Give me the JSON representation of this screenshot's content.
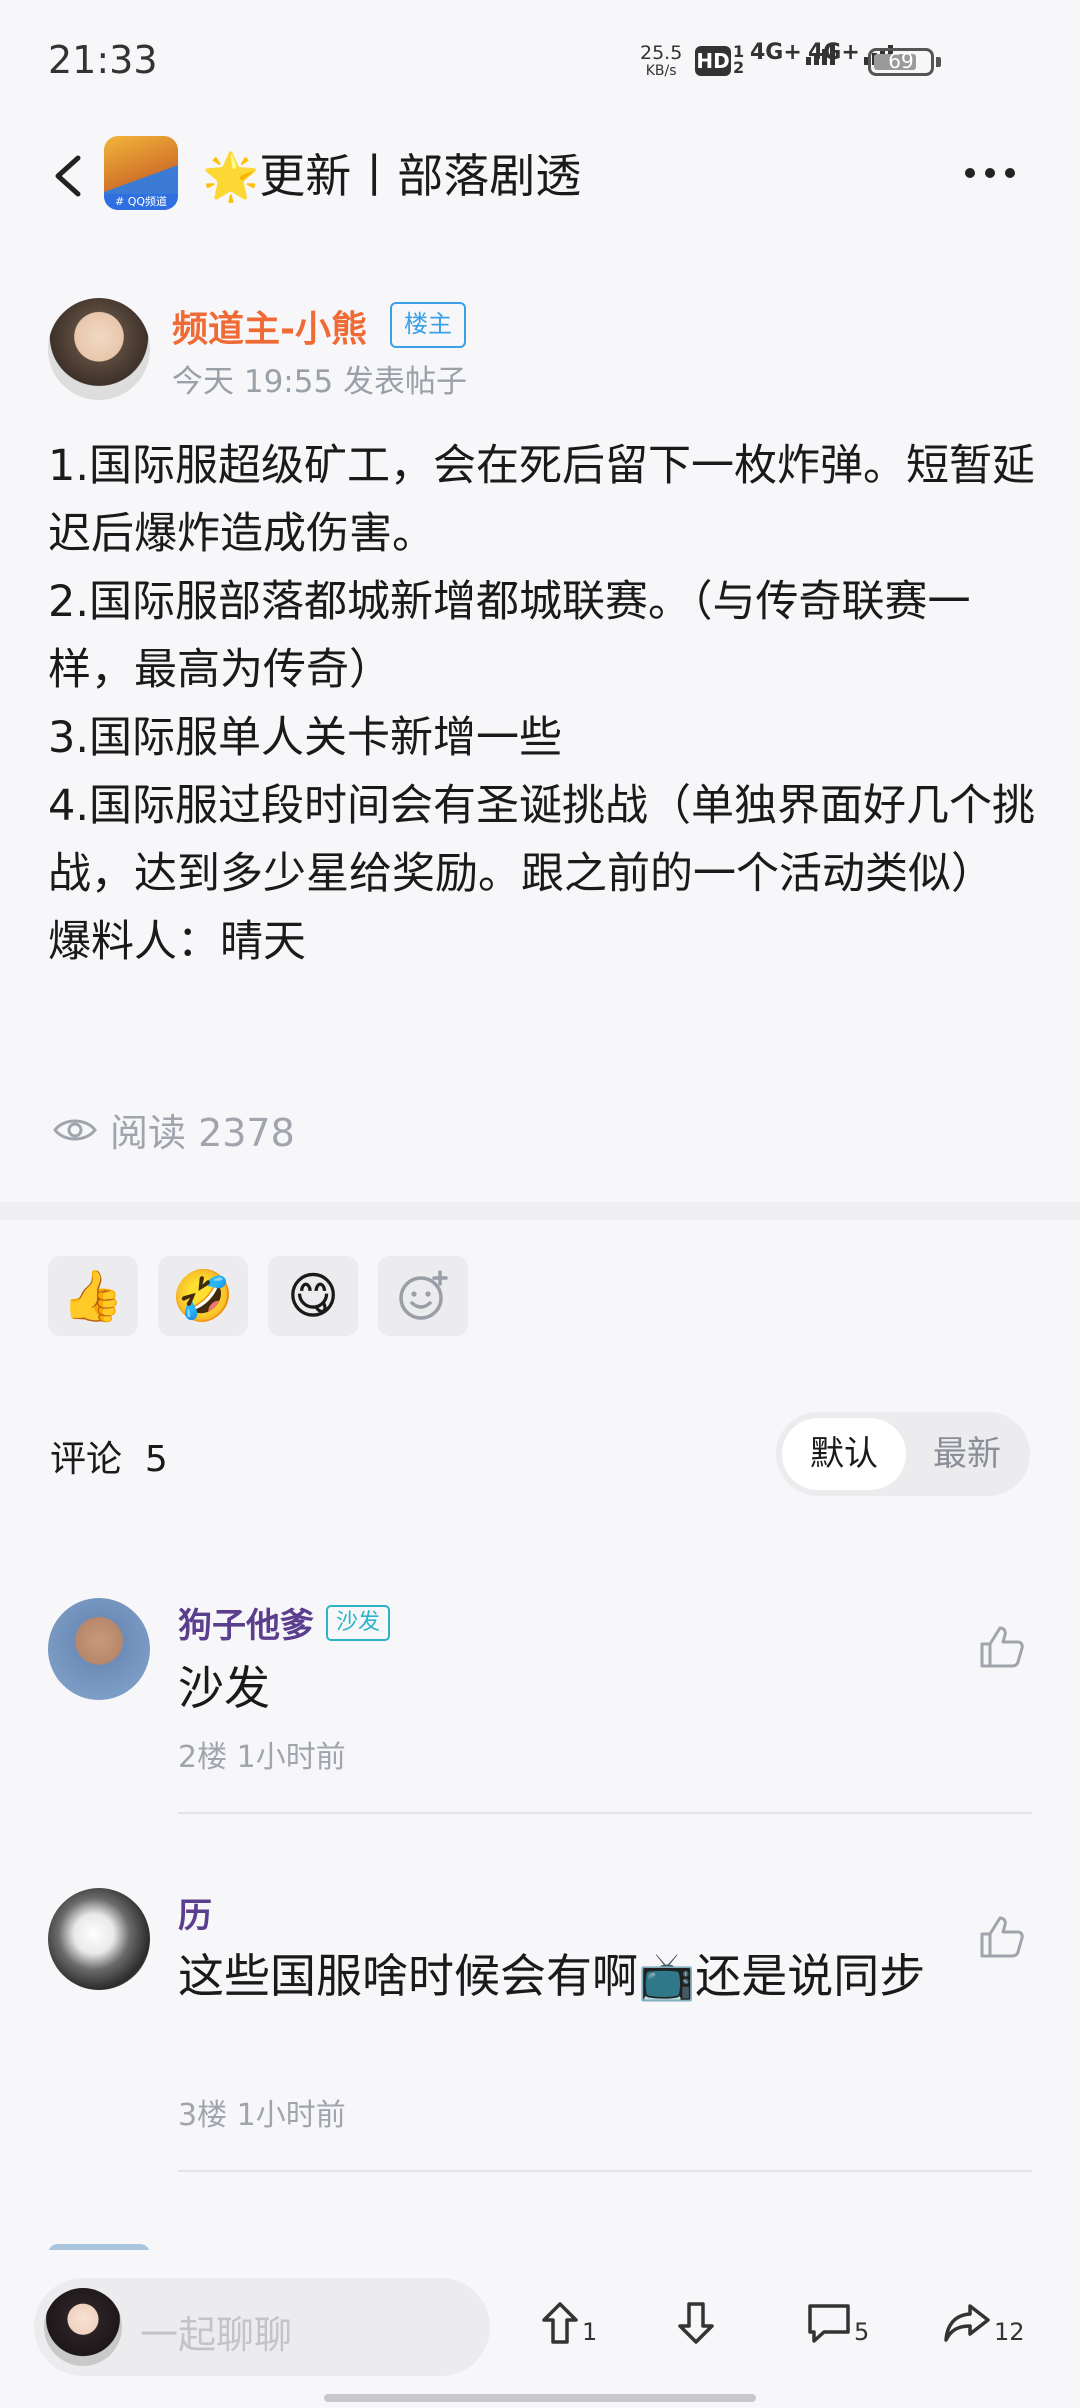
{
  "status_bar": {
    "time": "21:33",
    "net_speed_value": "25.5",
    "net_speed_unit": "KB/s",
    "hd_label": "HD",
    "sim1_label": "4G+",
    "sim2_label": "4G+",
    "battery": "69"
  },
  "header": {
    "title": "🌟更新丨部落剧透",
    "channel_logo_text": "# QQ频道"
  },
  "post": {
    "author": "频道主-小熊",
    "op_badge": "楼主",
    "time": "今天 19:55 发表帖子",
    "lines": [
      "1.国际服超级矿工，会在死后留下一枚炸弹。短暂延迟后爆炸造成伤害。",
      "2.国际服部落都城新增都城联赛。（与传奇联赛一样，最高为传奇）",
      "3.国际服单人关卡新增一些",
      "4.国际服过段时间会有圣诞挑战（单独界面好几个挑战，达到多少星给奖励。跟之前的一个活动类似）",
      "爆料人：晴天"
    ],
    "reads": "阅读 2378"
  },
  "reactions": {
    "thumbs": "👍",
    "laugh_cry": "🤣",
    "yum": "😋"
  },
  "comments_section": {
    "label": "评论  5",
    "sort_default": "默认",
    "sort_latest": "最新"
  },
  "comments": [
    {
      "name": "狗子他爹",
      "badge": "沙发",
      "text": "沙发",
      "meta": "2楼 1小时前"
    },
    {
      "name": "历",
      "badge": "",
      "text_before": "这些国服啥时候会有啊",
      "emoji": "📺",
      "text_after": "还是说同步",
      "meta": "3楼 1小时前"
    }
  ],
  "bottom_bar": {
    "input_placeholder": "一起聊聊",
    "upvote_count": "1",
    "comment_count": "5",
    "share_count": "12"
  }
}
